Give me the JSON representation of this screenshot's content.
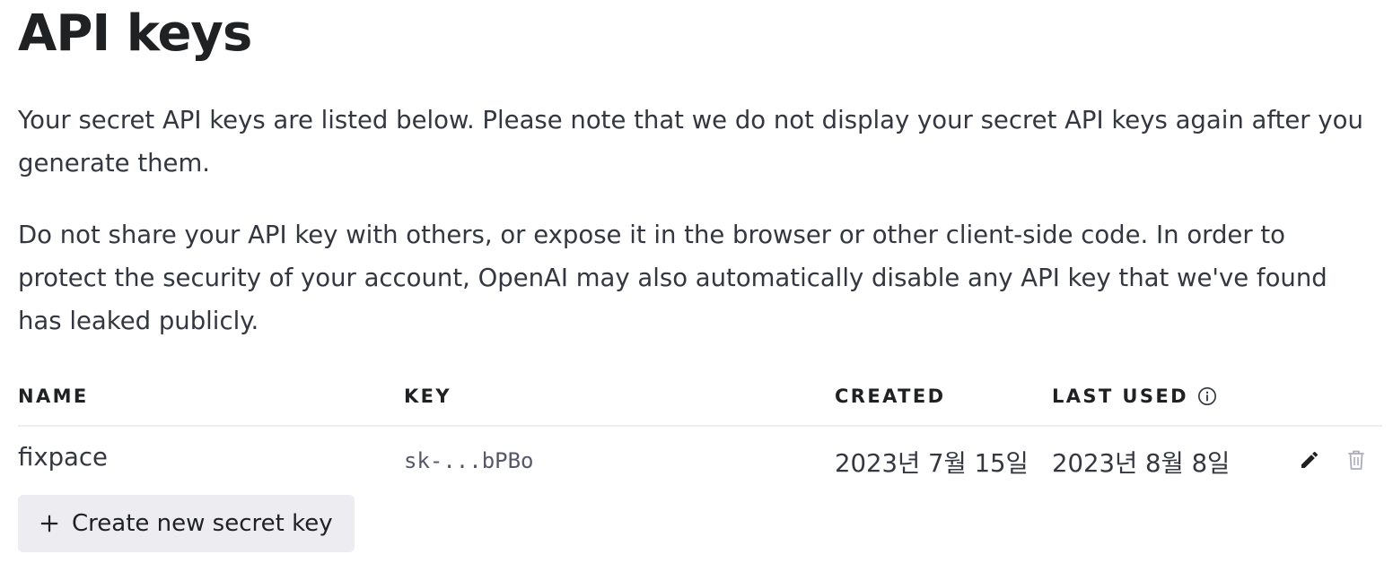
{
  "header": {
    "title": "API keys"
  },
  "description": {
    "paragraph_1": "Your secret API keys are listed below. Please note that we do not display your secret API keys again after you generate them.",
    "paragraph_2": "Do not share your API key with others, or expose it in the browser or other client-side code. In order to protect the security of your account, OpenAI may also automatically disable any API key that we've found has leaked publicly."
  },
  "table": {
    "columns": {
      "name": "NAME",
      "key": "KEY",
      "created": "CREATED",
      "last_used": "LAST USED"
    },
    "rows": [
      {
        "name": "fixpace",
        "key": "sk-...bPBo",
        "created": "2023년 7월 15일",
        "last_used": "2023년 8월 8일"
      }
    ]
  },
  "actions": {
    "create_label": "Create new secret key"
  },
  "icons": {
    "info": "info-circle-icon",
    "edit": "pencil-icon",
    "delete": "trash-icon",
    "add": "plus-icon"
  },
  "colors": {
    "text_primary": "#202123",
    "text_body": "#353740",
    "button_bg": "#ececf1",
    "divider": "#ececf1",
    "delete_icon": "#acacbe"
  }
}
